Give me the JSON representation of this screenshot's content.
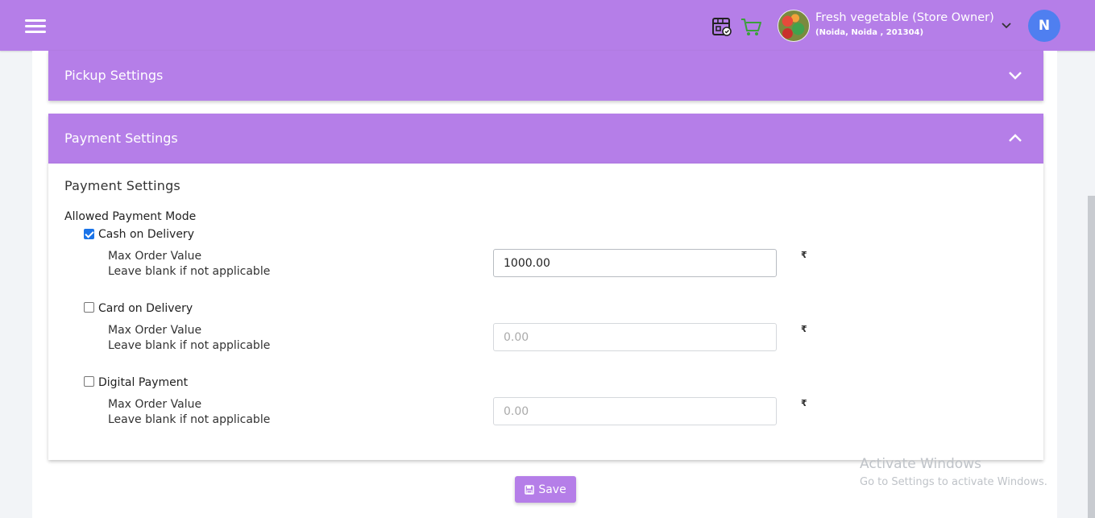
{
  "header": {
    "store_name": "Fresh vegetable (Store Owner)",
    "store_address": "(Noida, Noida , 201304)",
    "user_initial": "N",
    "accent_color": "#b57ee8",
    "avatar_color": "#4f7ff0"
  },
  "panels": {
    "pickup": {
      "title": "Pickup Settings",
      "expanded": false
    },
    "payment": {
      "title": "Payment Settings",
      "expanded": true
    }
  },
  "payment": {
    "section_title": "Payment Settings",
    "mode_label": "Allowed Payment Mode",
    "options": [
      {
        "label": "Cash on Delivery",
        "checked": true,
        "max_label": "Max Order Value",
        "hint": "Leave blank if not applicable",
        "value": "1000.00",
        "placeholder": "0.00",
        "currency": "₹"
      },
      {
        "label": "Card on Delivery",
        "checked": false,
        "max_label": "Max Order Value",
        "hint": "Leave blank if not applicable",
        "value": "",
        "placeholder": "0.00",
        "currency": "₹"
      },
      {
        "label": "Digital Payment",
        "checked": false,
        "max_label": "Max Order Value",
        "hint": "Leave blank if not applicable",
        "value": "",
        "placeholder": "0.00",
        "currency": "₹"
      }
    ]
  },
  "save_label": "Save",
  "watermark": {
    "line1": "Activate Windows",
    "line2": "Go to Settings to activate Windows."
  }
}
